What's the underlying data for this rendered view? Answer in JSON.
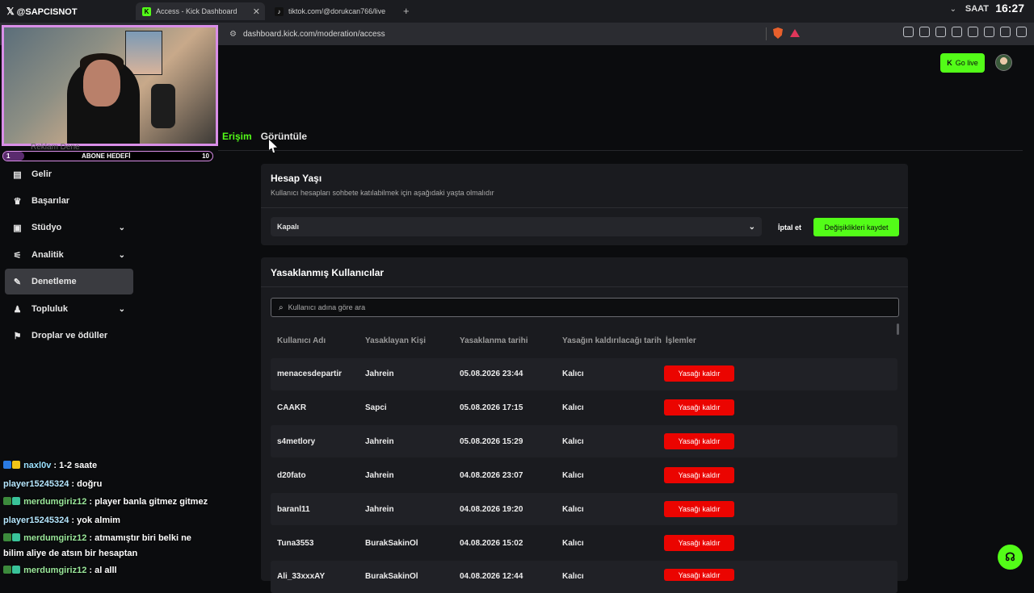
{
  "browser": {
    "tabs": [
      {
        "label": "Access - Kick Dashboard",
        "active": true
      },
      {
        "label": "tiktok.com/@dorukcan766/live",
        "active": false
      }
    ],
    "url": "dashboard.kick.com/moderation/access",
    "clock_label": "SAAT",
    "clock": "16:27"
  },
  "overlay": {
    "brand": "@SAPCISNOT",
    "sub_goal": {
      "left": "1",
      "label": "ABONE HEDEFİ",
      "right": "10",
      "progress": 0.1
    },
    "ghost_text": "Reklam  Dene"
  },
  "header": {
    "go_live": "Go live"
  },
  "tabs": {
    "access": "Erişim",
    "view": "Görüntüle"
  },
  "sidebar": {
    "items": [
      {
        "label": "Gelir",
        "icon": "revenue-icon"
      },
      {
        "label": "Başarılar",
        "icon": "trophy-icon"
      },
      {
        "label": "Stüdyo",
        "icon": "studio-icon"
      },
      {
        "label": "Analitik",
        "icon": "analytics-icon"
      },
      {
        "label": "Denetleme",
        "icon": "wrench-icon",
        "active": true
      },
      {
        "label": "Topluluk",
        "icon": "community-icon"
      },
      {
        "label": "Droplar ve ödüller",
        "icon": "drops-icon"
      }
    ]
  },
  "account_age": {
    "title": "Hesap Yaşı",
    "subtitle": "Kullanıcı hesapları sohbete katılabilmek için aşağıdaki yaşta olmalıdır",
    "selected": "Kapalı",
    "cancel": "İptal et",
    "save": "Değişiklikleri kaydet"
  },
  "banned": {
    "title": "Yasaklanmış Kullanıcılar",
    "search_placeholder": "Kullanıcı adına göre ara",
    "columns": [
      "Kullanıcı Adı",
      "Yasaklayan Kişi",
      "Yasaklanma tarihi",
      "Yasağın kaldırılacağı tarih",
      "İşlemler"
    ],
    "unban_label": "Yasağı kaldır",
    "rows": [
      {
        "user": "menacesdepartir",
        "by": "Jahrein",
        "date": "05.08.2026 23:44",
        "until": "Kalıcı"
      },
      {
        "user": "CAAKR",
        "by": "Sapci",
        "date": "05.08.2026 17:15",
        "until": "Kalıcı"
      },
      {
        "user": "s4metlory",
        "by": "Jahrein",
        "date": "05.08.2026 15:29",
        "until": "Kalıcı"
      },
      {
        "user": "d20fato",
        "by": "Jahrein",
        "date": "04.08.2026 23:07",
        "until": "Kalıcı"
      },
      {
        "user": "baranl11",
        "by": "Jahrein",
        "date": "04.08.2026 19:20",
        "until": "Kalıcı"
      },
      {
        "user": "Tuna3553",
        "by": "BurakSakinOl",
        "date": "04.08.2026 15:02",
        "until": "Kalıcı"
      },
      {
        "user": "Ali_33xxxAY",
        "by": "BurakSakinOl",
        "date": "04.08.2026 12:44",
        "until": "Kalıcı"
      }
    ]
  },
  "chat": [
    {
      "user": "naxl0v",
      "text": " : 1-2 saate"
    },
    {
      "user": "player15245324",
      "text": " : doğru"
    },
    {
      "user": "merdumgiriz12",
      "text": " : player banla gitmez gitmez"
    },
    {
      "user": "player15245324",
      "text": " : yok almim"
    },
    {
      "user": "merdumgiriz12",
      "text": " : atmamıştır biri belki ne"
    },
    {
      "user": "",
      "text": "bilim aliye de atsın bir hesaptan"
    },
    {
      "user": "merdumgiriz12",
      "text": " : al alll"
    }
  ],
  "colors": {
    "accent": "#53fc18",
    "danger": "#eb0400",
    "overlay_border": "#d98ee8"
  }
}
